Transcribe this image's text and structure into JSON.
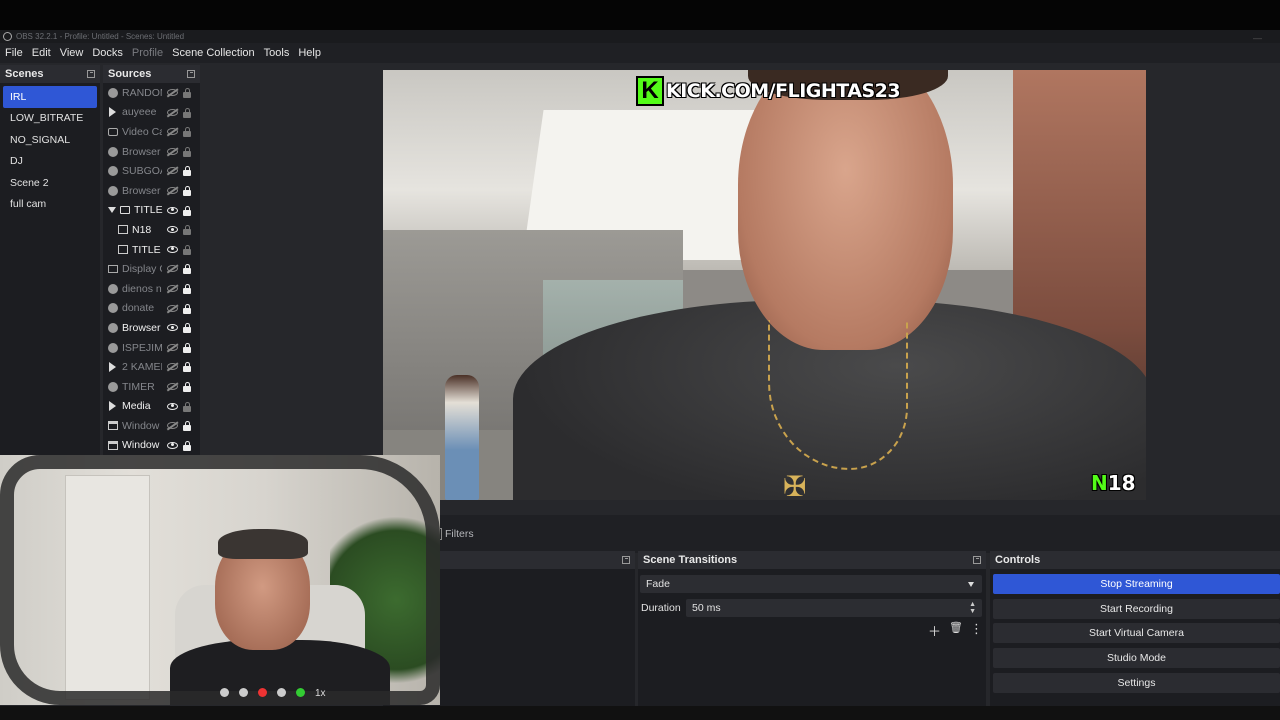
{
  "window": {
    "title": "OBS 32.2.1 - Profile: Untitled - Scenes: Untitled",
    "minimize": "—"
  },
  "menu": [
    "File",
    "Edit",
    "View",
    "Docks",
    "Profile",
    "Scene Collection",
    "Tools",
    "Help"
  ],
  "scenes": {
    "header": "Scenes",
    "items": [
      "IRL",
      "LOW_BITRATE",
      "NO_SIGNAL",
      "DJ",
      "Scene 2",
      "full cam"
    ],
    "selected": "IRL"
  },
  "sources": {
    "header": "Sources",
    "items": [
      {
        "name": "RANDOM",
        "icon": "globe-icon",
        "visible": false,
        "locked": false
      },
      {
        "name": "auyeee",
        "icon": "media-icon",
        "visible": false,
        "locked": false
      },
      {
        "name": "Video Ca",
        "icon": "camera-icon",
        "visible": false,
        "locked": false
      },
      {
        "name": "Browser",
        "icon": "globe-icon",
        "visible": false,
        "locked": false
      },
      {
        "name": "SUBGOA",
        "icon": "globe-icon",
        "visible": false,
        "locked": true
      },
      {
        "name": "Browser",
        "icon": "globe-icon",
        "visible": false,
        "locked": true
      },
      {
        "name": "TITLE",
        "icon": "folder-icon",
        "visible": true,
        "locked": true,
        "group": true
      },
      {
        "name": "N18",
        "icon": "image-icon",
        "visible": true,
        "locked": false,
        "child": true
      },
      {
        "name": "TITLE",
        "icon": "image-icon",
        "visible": true,
        "locked": false,
        "child": true
      },
      {
        "name": "Display C",
        "icon": "monitor-icon",
        "visible": false,
        "locked": true
      },
      {
        "name": "dienos n",
        "icon": "globe-icon",
        "visible": false,
        "locked": true
      },
      {
        "name": "donate",
        "icon": "globe-icon",
        "visible": false,
        "locked": true
      },
      {
        "name": "Browser",
        "icon": "globe-icon",
        "visible": true,
        "locked": true
      },
      {
        "name": "ISPEJIMA",
        "icon": "globe-icon",
        "visible": false,
        "locked": true
      },
      {
        "name": "2 KAMEF",
        "icon": "media-icon",
        "visible": false,
        "locked": true
      },
      {
        "name": "TIMER",
        "icon": "globe-icon",
        "visible": false,
        "locked": true
      },
      {
        "name": "Media",
        "icon": "media-icon",
        "visible": true,
        "locked": false
      },
      {
        "name": "Window",
        "icon": "window-icon",
        "visible": false,
        "locked": true
      },
      {
        "name": "Window",
        "icon": "window-icon",
        "visible": true,
        "locked": true
      }
    ]
  },
  "preview": {
    "banner_text": "KICK.COM/FLIGHTAS23",
    "banner_logo": "K",
    "badge_letter": "N",
    "badge_number": "18"
  },
  "filters_label": "Filters",
  "transitions": {
    "header": "Scene Transitions",
    "selected": "Fade",
    "duration_label": "Duration",
    "duration_value": "50 ms"
  },
  "controls": {
    "header": "Controls",
    "buttons": [
      "Stop Streaming",
      "Start Recording",
      "Start Virtual Camera",
      "Studio Mode",
      "Settings"
    ]
  },
  "webcam": {
    "toolbar_label": "1x"
  },
  "colors": {
    "accent": "#2f57d6",
    "kick_green": "#53fc18"
  }
}
